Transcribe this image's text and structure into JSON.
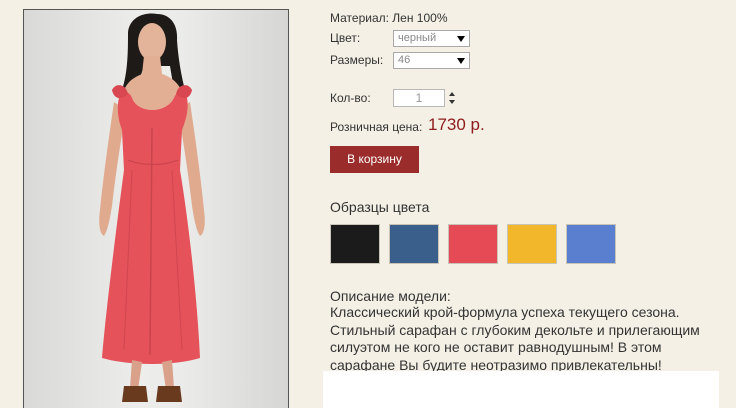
{
  "product": {
    "material": "Материал: Лен 100%",
    "color_label": "Цвет:",
    "color_value": "черный",
    "size_label": "Размеры:",
    "size_value": "46",
    "qty_label": "Кол-во:",
    "qty_value": "1",
    "price_label": "Розничная цена:",
    "price_value": "1730 р.",
    "cart_button": "В корзину"
  },
  "samples": {
    "title": "Образцы цвета",
    "colors": [
      "#1b1b1b",
      "#3a5f8a",
      "#e64b55",
      "#f2b72a",
      "#5b7fcf"
    ]
  },
  "description": {
    "title": "Описание модели:",
    "text": "Классический крой-формула успеха текущего сезона. Стильный сарафан с глубоким декольте и прилегающим силуэтом не кого не оставит равнодушным! В этом сарафане Вы будите неотразимо привлекательны!"
  }
}
